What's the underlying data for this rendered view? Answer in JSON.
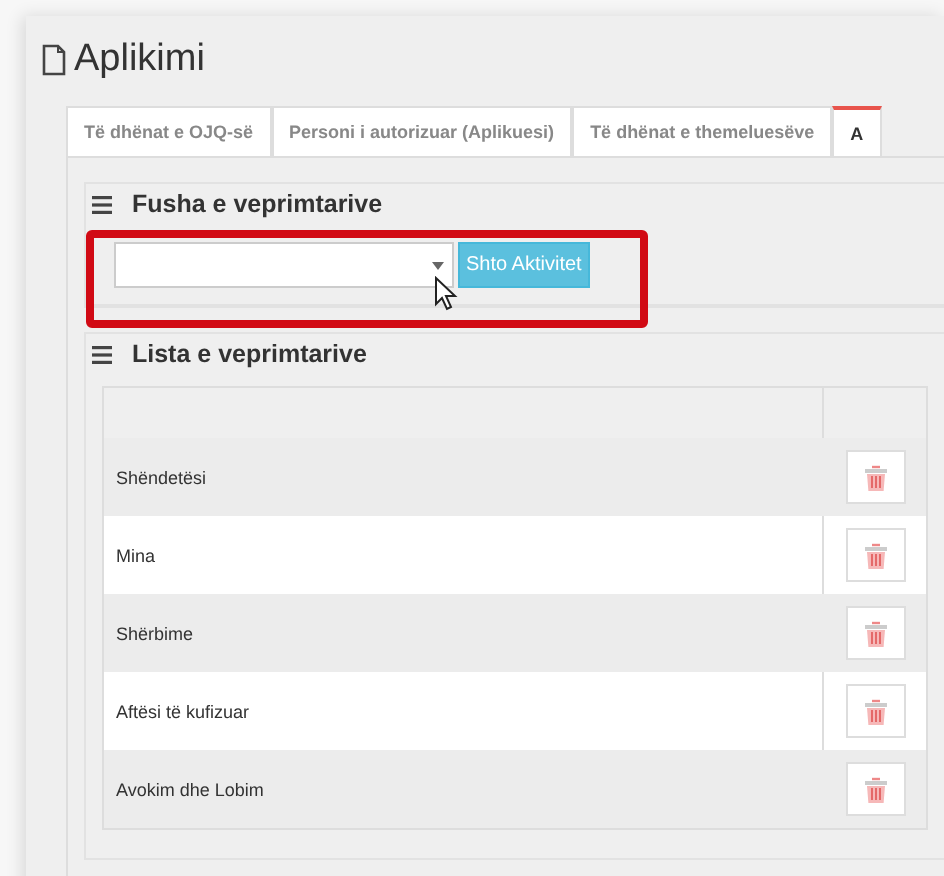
{
  "page": {
    "title": "Aplikimi"
  },
  "tabs": [
    {
      "label": "Të dhënat e OJQ-së",
      "selected": false
    },
    {
      "label": "Personi i autorizuar (Aplikuesi)",
      "selected": false
    },
    {
      "label": "Të dhënat e themeluesëve",
      "selected": false
    },
    {
      "label": "A",
      "selected": true
    }
  ],
  "activity_field": {
    "title": "Fusha e veprimtarive",
    "button": "Shto Aktivitet"
  },
  "activity_list": {
    "title": "Lista e veprimtarive",
    "rows": [
      {
        "name": "Shëndetësi"
      },
      {
        "name": "Mina"
      },
      {
        "name": "Shërbime"
      },
      {
        "name": "Aftësi të kufizuar"
      },
      {
        "name": "Avokim dhe Lobim"
      }
    ]
  }
}
